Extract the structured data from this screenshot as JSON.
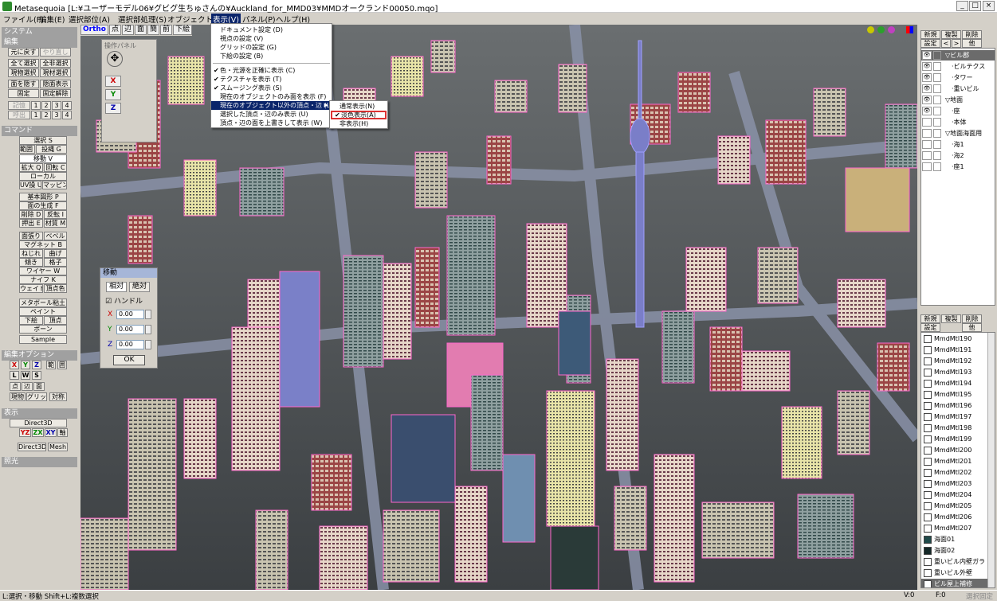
{
  "window": {
    "title": "Metasequoia [L:¥ユーザーモデル06¥グビグ生ちゅさんの¥Auckland_for_MMD03¥MMDオークランド00050.mqo]",
    "min": "_",
    "max": "□",
    "close": "×"
  },
  "menu": [
    "ファイル(F)",
    "編集(E)",
    "選択部位(A)",
    "選択部処理(S)",
    "オブジェクト(O)",
    "表示(V)",
    "パネル(P)",
    "ヘルプ(H)"
  ],
  "left": {
    "system_header": "システム",
    "edit_header": "編集",
    "undo": "元に戻す",
    "redo": "やり直し",
    "select_all": "全て選択",
    "deselect_all": "全非選択",
    "cur_select": "現物選択",
    "cur_mat": "現材選択",
    "hide": "面を隠す",
    "show": "隠面表示",
    "fix": "固定",
    "unfix": "固定解除",
    "memory": "記憶",
    "recall": "呼出",
    "nums": [
      "1",
      "2",
      "3",
      "4"
    ],
    "command_header": "コマンド",
    "cmd": [
      "選択 S",
      "範囲 R",
      "投縄 G",
      "移動 V",
      "拡大 Q",
      "回転 C",
      "ローカル",
      "UV操 U",
      "マッピング",
      "基本図形 P",
      "面の生成 F",
      "削除 D",
      "反転 I",
      "押出 E",
      "材質 M",
      "面張り",
      "ベベル",
      "マグネット B",
      "ねじれ",
      "曲げ",
      "傾き",
      "格子",
      "ワイヤー W",
      "ナイフ K",
      "ウェイト",
      "頂点色",
      "メタボール粘土",
      "ペイント",
      "下絵",
      "ボーン",
      "Sample"
    ],
    "editopt_header": "編集オプション",
    "axes": [
      "X",
      "Y",
      "Z"
    ],
    "editopt": [
      "範",
      "囲",
      "L",
      "W",
      "S",
      "点",
      "辺",
      "面",
      "現物",
      "グリッド",
      "対称"
    ],
    "display_header": "表示",
    "d3d": "Direct3D",
    "planes": [
      "YZ",
      "ZX",
      "XY",
      "軸"
    ],
    "d3d2": "Direct3D",
    "mesh": "Mesh",
    "light_header": "照光"
  },
  "viewport": {
    "tabs": [
      "Ortho",
      "点",
      "辺",
      "面",
      "簡",
      "前",
      "下絵"
    ],
    "minipanel": {
      "label": "操作パネル",
      "x": "X",
      "y": "Y",
      "z": "Z"
    }
  },
  "move_dialog": {
    "title": "移動",
    "rel": "相対",
    "abs": "絶対",
    "handle": "ハンドル",
    "x_label": "X",
    "y_label": "Y",
    "z_label": "Z",
    "x": "0.00",
    "y": "0.00",
    "z": "0.00",
    "ok": "OK"
  },
  "display_menu": {
    "items": [
      {
        "label": "ドキュメント設定 (D)",
        "check": ""
      },
      {
        "label": "視点の設定 (V)",
        "check": ""
      },
      {
        "label": "グリッドの設定 (G)",
        "check": ""
      },
      {
        "label": "下絵の設定 (B)",
        "check": ""
      },
      {
        "label": "色・光源を正確に表示 (C)",
        "check": "✔"
      },
      {
        "label": "テクスチャを表示 (T)",
        "check": "✔"
      },
      {
        "label": "スムージング表示 (S)",
        "check": "✔"
      },
      {
        "label": "現在のオブジェクトのみ面を表示 (F)",
        "check": ""
      },
      {
        "label": "現在のオブジェクト以外の頂点・辺 (L)",
        "check": "",
        "arrow": "▶"
      },
      {
        "label": "選択した頂点・辺のみ表示 (U)",
        "check": ""
      },
      {
        "label": "頂点・辺の面を上書きして表示 (W)",
        "check": ""
      }
    ],
    "sub": [
      {
        "label": "通常表示(N)",
        "check": ""
      },
      {
        "label": "淡色表示(A)",
        "check": "✔"
      },
      {
        "label": "非表示(H)",
        "check": ""
      }
    ]
  },
  "right": {
    "new": "新規",
    "dup": "複製",
    "del": "削除",
    "settings": "設定",
    "left": "<",
    "right": ">",
    "other": "他",
    "objects": [
      {
        "name": "ビル郡",
        "indent": 0,
        "eye": true,
        "exp": "▽"
      },
      {
        "name": "ビルテクス",
        "indent": 1,
        "eye": true,
        "exp": ""
      },
      {
        "name": "タワー",
        "indent": 1,
        "eye": true,
        "exp": ""
      },
      {
        "name": "重いビル",
        "indent": 1,
        "eye": true,
        "exp": ""
      },
      {
        "name": "地面",
        "indent": 0,
        "eye": true,
        "exp": "▽"
      },
      {
        "name": "座",
        "indent": 1,
        "eye": true,
        "exp": ""
      },
      {
        "name": "本体",
        "indent": 1,
        "eye": false,
        "exp": ""
      },
      {
        "name": "地面海面用",
        "indent": 0,
        "eye": false,
        "exp": "▽"
      },
      {
        "name": "海1",
        "indent": 1,
        "eye": false,
        "exp": ""
      },
      {
        "name": "海2",
        "indent": 1,
        "eye": false,
        "exp": ""
      },
      {
        "name": "座1",
        "indent": 1,
        "eye": false,
        "exp": ""
      }
    ],
    "mat_new": "新規",
    "mat_dup": "複製",
    "mat_del": "削除",
    "mat_settings": "設定",
    "mat_other": "他",
    "materials": [
      "MmdMtl190",
      "MmdMtl191",
      "MmdMtl192",
      "MmdMtl193",
      "MmdMtl194",
      "MmdMtl195",
      "MmdMtl196",
      "MmdMtl197",
      "MmdMtl198",
      "MmdMtl199",
      "MmdMtl200",
      "MmdMtl201",
      "MmdMtl202",
      "MmdMtl203",
      "MmdMtl204",
      "MmdMtl205",
      "MmdMtl206",
      "MmdMtl207",
      "海面01",
      "海面02",
      "重いビル内壁ガラ",
      "重いビル外壁",
      "ビル屋上補修"
    ]
  },
  "status": {
    "hint": "L:選択・移動  Shift+L:複数選択",
    "v": "V:0",
    "f": "F:0",
    "mode": "選択固定"
  },
  "colors": {
    "accent": "#0a246a",
    "wire": "#ff66cc",
    "highlight": "#dd3333"
  }
}
